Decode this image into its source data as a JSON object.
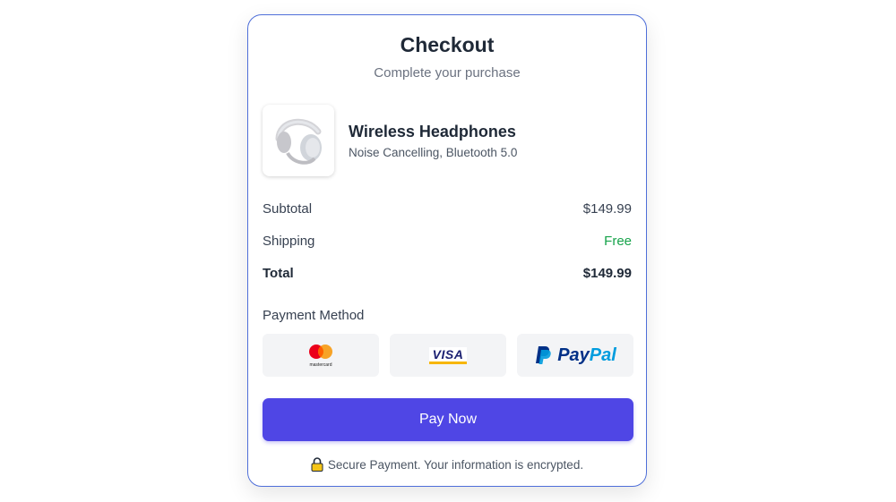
{
  "header": {
    "title": "Checkout",
    "subtitle": "Complete your purchase"
  },
  "product": {
    "name": "Wireless Headphones",
    "description": "Noise Cancelling, Bluetooth 5.0",
    "image_icon": "headphones-image"
  },
  "summary": {
    "subtotal_label": "Subtotal",
    "subtotal_value": "$149.99",
    "shipping_label": "Shipping",
    "shipping_value": "Free",
    "total_label": "Total",
    "total_value": "$149.99"
  },
  "payment": {
    "label": "Payment Method",
    "methods": [
      {
        "name": "mastercard",
        "text": "mastercard"
      },
      {
        "name": "visa",
        "text": "VISA"
      },
      {
        "name": "paypal",
        "text_a": "Pay",
        "text_b": "Pal"
      }
    ]
  },
  "actions": {
    "pay_label": "Pay Now"
  },
  "footer": {
    "secure_text": "Secure Payment. Your information is encrypted.",
    "secure_icon": "lock-icon"
  },
  "colors": {
    "accent": "#4f46e5",
    "free": "#16a34a",
    "card_border": "#4f6fd9"
  }
}
